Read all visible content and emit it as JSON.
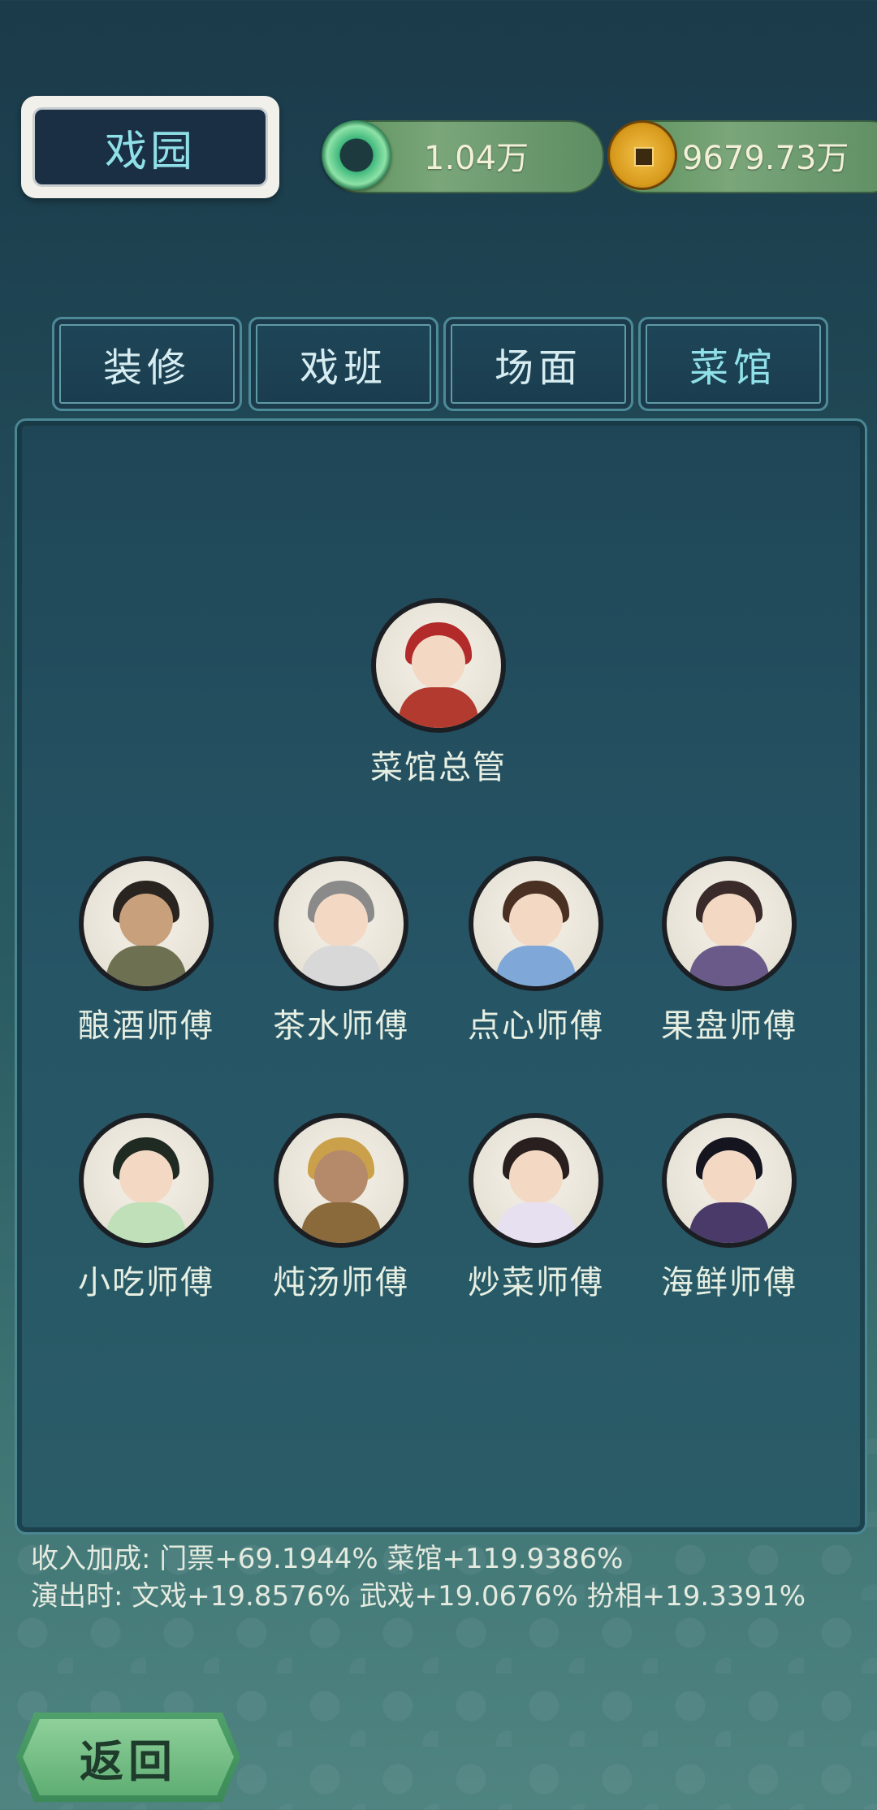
{
  "header": {
    "title": "戏园",
    "jade_amount": "1.04万",
    "coin_amount": "9679.73万"
  },
  "tabs": [
    {
      "label": "装修",
      "active": false
    },
    {
      "label": "戏班",
      "active": false
    },
    {
      "label": "场面",
      "active": false
    },
    {
      "label": "菜馆",
      "active": true
    }
  ],
  "manager": {
    "label": "菜馆总管"
  },
  "staff": [
    {
      "label": "酿酒师傅"
    },
    {
      "label": "茶水师傅"
    },
    {
      "label": "点心师傅"
    },
    {
      "label": "果盘师傅"
    },
    {
      "label": "小吃师傅"
    },
    {
      "label": "炖汤师傅"
    },
    {
      "label": "炒菜师傅"
    },
    {
      "label": "海鲜师傅"
    }
  ],
  "stats": {
    "line1": "收入加成: 门票+69.1944% 菜馆+119.9386%",
    "line2": "演出时: 文戏+19.8576% 武戏+19.0676% 扮相+19.3391%"
  },
  "back_label": "返回",
  "colors": {
    "accent": "#8fe0e8",
    "panel": "#265566",
    "back_button": "#5fae74"
  }
}
